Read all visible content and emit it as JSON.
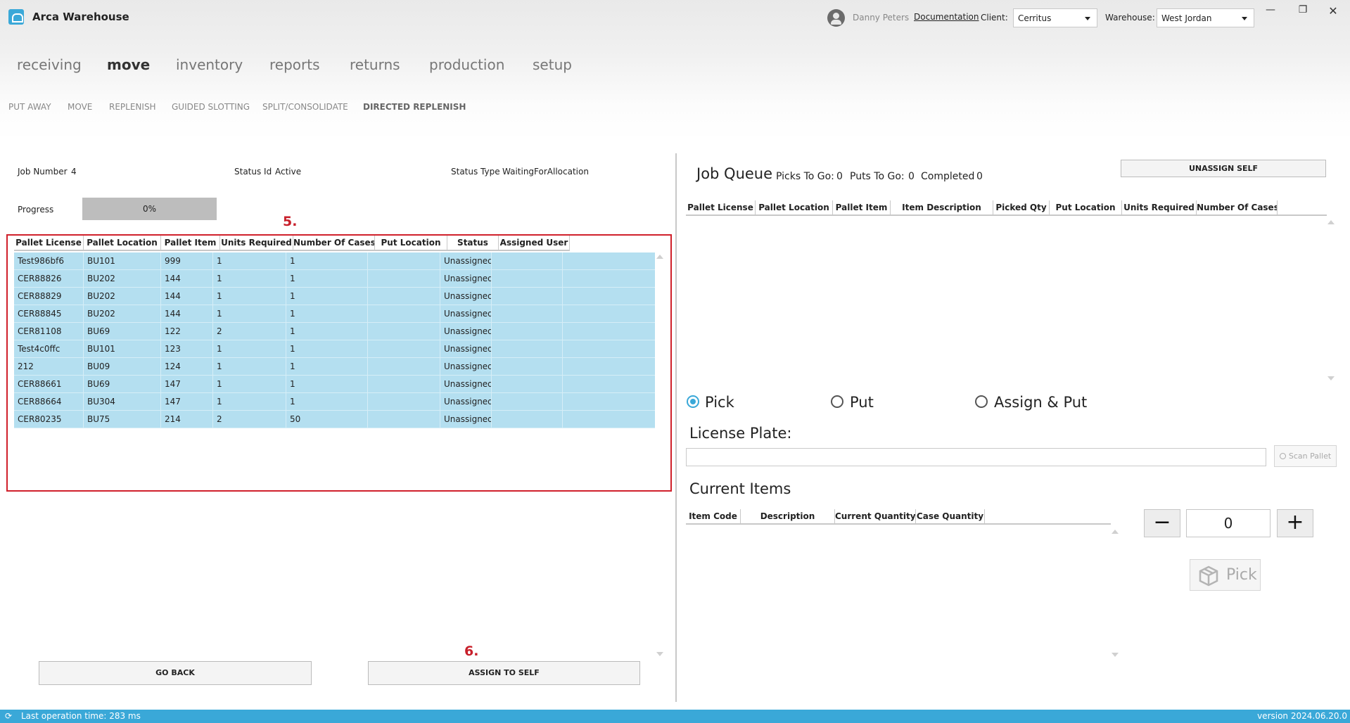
{
  "app": {
    "title": "Arca Warehouse"
  },
  "header": {
    "user_name": "Danny Peters",
    "documentation_link": "Documentation",
    "client_label": "Client:",
    "client_value": "Cerritus",
    "warehouse_label": "Warehouse:",
    "warehouse_value": "West Jordan"
  },
  "nav": {
    "items": [
      "receiving",
      "move",
      "inventory",
      "reports",
      "returns",
      "production",
      "setup"
    ],
    "active": "move"
  },
  "subnav": {
    "items": [
      "PUT AWAY",
      "MOVE",
      "REPLENISH",
      "GUIDED SLOTTING",
      "SPLIT/CONSOLIDATE",
      "DIRECTED REPLENISH"
    ],
    "active": "DIRECTED REPLENISH"
  },
  "job": {
    "number_label": "Job Number",
    "number_value": "4",
    "status_id_label": "Status Id",
    "status_id_value": "Active",
    "status_type_label": "Status Type",
    "status_type_value": "WaitingForAllocation",
    "progress_label": "Progress",
    "progress_text": "0%",
    "progress_fraction": 0
  },
  "annotations": {
    "five": "5.",
    "six": "6."
  },
  "job_table": {
    "columns": [
      "Pallet License",
      "Pallet Location",
      "Pallet Item",
      "Units Required",
      "Number Of Cases",
      "Put Location",
      "Status",
      "Assigned User"
    ],
    "rows": [
      [
        "Test986bf6",
        "BU101",
        "999",
        "1",
        "1",
        "",
        "Unassigned",
        ""
      ],
      [
        "CER88826",
        "BU202",
        "144",
        "1",
        "1",
        "",
        "Unassigned",
        ""
      ],
      [
        "CER88829",
        "BU202",
        "144",
        "1",
        "1",
        "",
        "Unassigned",
        ""
      ],
      [
        "CER88845",
        "BU202",
        "144",
        "1",
        "1",
        "",
        "Unassigned",
        ""
      ],
      [
        "CER81108",
        "BU69",
        "122",
        "2",
        "1",
        "",
        "Unassigned",
        ""
      ],
      [
        "Test4c0ffc",
        "BU101",
        "123",
        "1",
        "1",
        "",
        "Unassigned",
        ""
      ],
      [
        "212",
        "BU09",
        "124",
        "1",
        "1",
        "",
        "Unassigned",
        ""
      ],
      [
        "CER88661",
        "BU69",
        "147",
        "1",
        "1",
        "",
        "Unassigned",
        ""
      ],
      [
        "CER88664",
        "BU304",
        "147",
        "1",
        "1",
        "",
        "Unassigned",
        ""
      ],
      [
        "CER80235",
        "BU75",
        "214",
        "2",
        "50",
        "",
        "Unassigned",
        ""
      ]
    ]
  },
  "buttons": {
    "go_back": "GO BACK",
    "assign_to_self": "ASSIGN TO SELF",
    "unassign_self": "UNASSIGN SELF",
    "scan_pallet": "Scan Pallet",
    "pick": "Pick"
  },
  "job_queue": {
    "title": "Job Queue",
    "picks_label": "Picks To Go:",
    "picks_value": "0",
    "puts_label": "Puts To Go:",
    "puts_value": "0",
    "completed_label": "Completed",
    "completed_value": "0",
    "columns": [
      "Pallet License",
      "Pallet Location",
      "Pallet Item",
      "Item Description",
      "Picked Qty",
      "Put Location",
      "Units Required",
      "Number Of Cases"
    ]
  },
  "mode": {
    "options": [
      "Pick",
      "Put",
      "Assign & Put"
    ],
    "selected": "Pick"
  },
  "license_plate": {
    "label": "License Plate:",
    "value": ""
  },
  "current_items": {
    "title": "Current Items",
    "columns": [
      "Item Code",
      "Description",
      "Current Quantity",
      "Case Quantity"
    ]
  },
  "quantity": {
    "minus": "−",
    "value": "0",
    "plus": "+"
  },
  "status_bar": {
    "last_op": "Last operation time:  283 ms",
    "version": "version 2024.06.20.0"
  },
  "colors": {
    "accent": "#3aa8d8",
    "row_bg": "#b4dff0",
    "annotation": "#c8202b"
  }
}
